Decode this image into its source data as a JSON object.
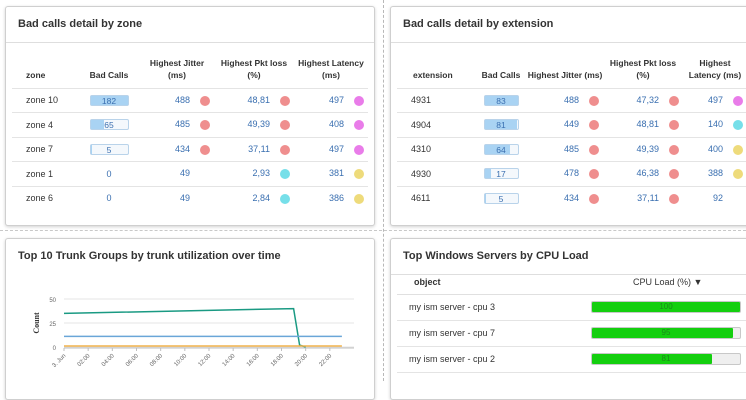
{
  "zone_panel": {
    "title": "Bad calls detail by zone",
    "headers": [
      "zone",
      "Bad Calls",
      "Highest Jitter (ms)",
      "Highest Pkt loss (%)",
      "Highest Latency (ms)"
    ],
    "rows": [
      {
        "name": "zone 10",
        "bad_calls": "182",
        "bad_calls_fraction": 1.0,
        "jitter": "488",
        "jitter_color": "#ef8e8e",
        "loss": "48,81",
        "loss_color": "#ef8e8e",
        "latency": "497",
        "latency_color": "#e97ce9"
      },
      {
        "name": "zone 4",
        "bad_calls": "65",
        "bad_calls_fraction": 0.36,
        "jitter": "485",
        "jitter_color": "#ef8e8e",
        "loss": "49,39",
        "loss_color": "#ef8e8e",
        "latency": "408",
        "latency_color": "#e97ce9"
      },
      {
        "name": "zone 7",
        "bad_calls": "5",
        "bad_calls_fraction": 0.03,
        "jitter": "434",
        "jitter_color": "#ef8e8e",
        "loss": "37,11",
        "loss_color": "#ef8e8e",
        "latency": "497",
        "latency_color": "#e97ce9"
      },
      {
        "name": "zone 1",
        "bad_calls": "0",
        "bad_calls_fraction": 0,
        "jitter": "49",
        "jitter_color": "",
        "loss": "2,93",
        "loss_color": "#76dfe9",
        "latency": "381",
        "latency_color": "#eedb7b"
      },
      {
        "name": "zone 6",
        "bad_calls": "0",
        "bad_calls_fraction": 0,
        "jitter": "49",
        "jitter_color": "",
        "loss": "2,84",
        "loss_color": "#76dfe9",
        "latency": "386",
        "latency_color": "#eedb7b"
      }
    ]
  },
  "ext_panel": {
    "title": "Bad calls detail by extension",
    "headers": [
      "extension",
      "Bad Calls",
      "Highest Jitter (ms)",
      "Highest Pkt loss (%)",
      "Highest Latency (ms)"
    ],
    "rows": [
      {
        "name": "4931",
        "bad_calls": "83",
        "bad_calls_fraction": 1.0,
        "jitter": "488",
        "jitter_color": "#ef8e8e",
        "loss": "47,32",
        "loss_color": "#ef8e8e",
        "latency": "497",
        "latency_color": "#e97ce9"
      },
      {
        "name": "4904",
        "bad_calls": "81",
        "bad_calls_fraction": 0.97,
        "jitter": "449",
        "jitter_color": "#ef8e8e",
        "loss": "48,81",
        "loss_color": "#ef8e8e",
        "latency": "140",
        "latency_color": "#76dfe9"
      },
      {
        "name": "4310",
        "bad_calls": "64",
        "bad_calls_fraction": 0.77,
        "jitter": "485",
        "jitter_color": "#ef8e8e",
        "loss": "49,39",
        "loss_color": "#ef8e8e",
        "latency": "400",
        "latency_color": "#eedb7b"
      },
      {
        "name": "4930",
        "bad_calls": "17",
        "bad_calls_fraction": 0.2,
        "jitter": "478",
        "jitter_color": "#ef8e8e",
        "loss": "46,38",
        "loss_color": "#ef8e8e",
        "latency": "388",
        "latency_color": "#eedb7b"
      },
      {
        "name": "4611",
        "bad_calls": "5",
        "bad_calls_fraction": 0.06,
        "jitter": "434",
        "jitter_color": "#ef8e8e",
        "loss": "37,11",
        "loss_color": "#ef8e8e",
        "latency": "92",
        "latency_color": ""
      }
    ]
  },
  "trunk_panel": {
    "title": "Top 10 Trunk Groups by trunk utilization over time"
  },
  "chart_data": {
    "type": "line",
    "title": "",
    "xlabel": "",
    "ylabel": "Count",
    "ylim": [
      0,
      50
    ],
    "yticks": [
      "0",
      "25",
      "50"
    ],
    "xticks": [
      "3. Jun",
      "02:00",
      "04:00",
      "06:00",
      "08:00",
      "10:00",
      "12:00",
      "14:00",
      "16:00",
      "18:00",
      "20:00",
      "22:00"
    ],
    "grid": true,
    "series": [
      {
        "color": "#1a9a83",
        "x": [
          "00:00",
          "19:00",
          "19:30",
          "20:00"
        ],
        "y": [
          35,
          40,
          2,
          0
        ]
      },
      {
        "color": "#6aa6d8",
        "x": [
          "00:00",
          "23:00"
        ],
        "y": [
          11,
          11
        ]
      },
      {
        "color": "#f0b24c",
        "x": [
          "00:00",
          "23:00"
        ],
        "y": [
          1,
          1
        ]
      }
    ]
  },
  "cpu_panel": {
    "title": "Top Windows Servers by CPU Load",
    "col_object": "object",
    "col_cpu": "CPU Load (%) ▼",
    "rows": [
      {
        "name": "my ism server - cpu 3",
        "value": "100",
        "fraction": 1.0
      },
      {
        "name": "my ism server - cpu 7",
        "value": "95",
        "fraction": 0.95
      },
      {
        "name": "my ism server - cpu 2",
        "value": "81",
        "fraction": 0.81
      }
    ]
  }
}
